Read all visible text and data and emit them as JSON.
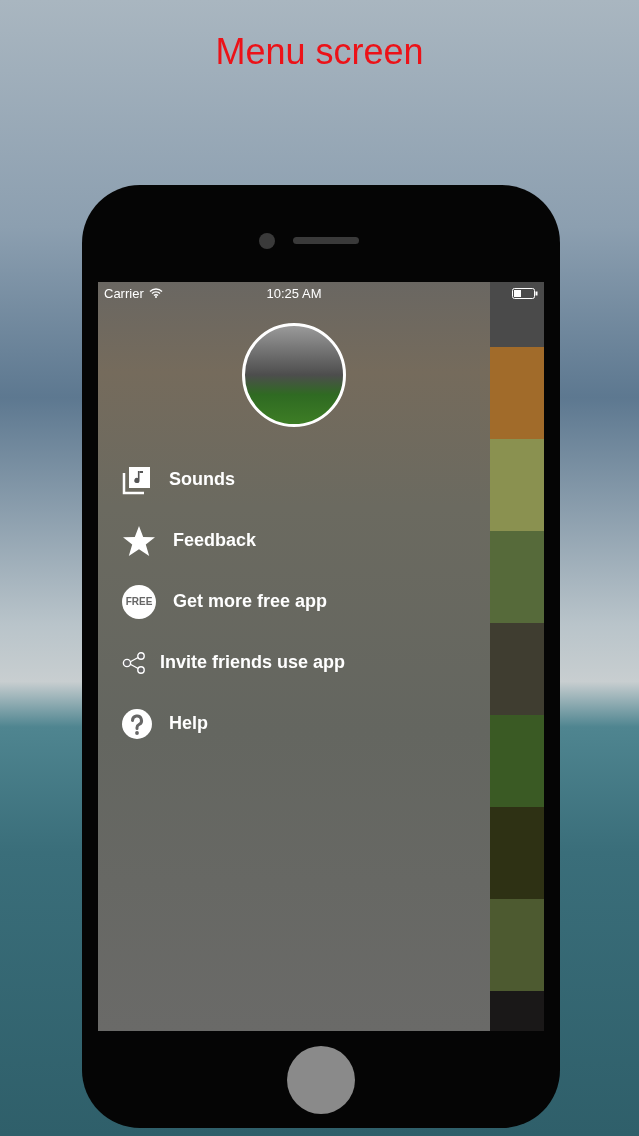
{
  "caption": "Menu screen",
  "status_bar": {
    "carrier": "Carrier",
    "time": "10:25 AM"
  },
  "menu": [
    {
      "kind": "sounds",
      "label": "Sounds"
    },
    {
      "kind": "star",
      "label": "Feedback"
    },
    {
      "kind": "free",
      "label": "Get more free app",
      "icon_text": "FREE"
    },
    {
      "kind": "share",
      "label": "Invite friends use app"
    },
    {
      "kind": "help",
      "label": "Help"
    }
  ],
  "tiles": [
    {
      "color": "#4a4a4a"
    },
    {
      "color": "#a16b2a"
    },
    {
      "color": "#8a9150"
    },
    {
      "color": "#566a3a"
    },
    {
      "color": "#3f3d30"
    },
    {
      "color": "#3a5a24"
    },
    {
      "color": "#2e3114"
    },
    {
      "color": "#4d5a30"
    },
    {
      "color": "#1a1818"
    }
  ]
}
